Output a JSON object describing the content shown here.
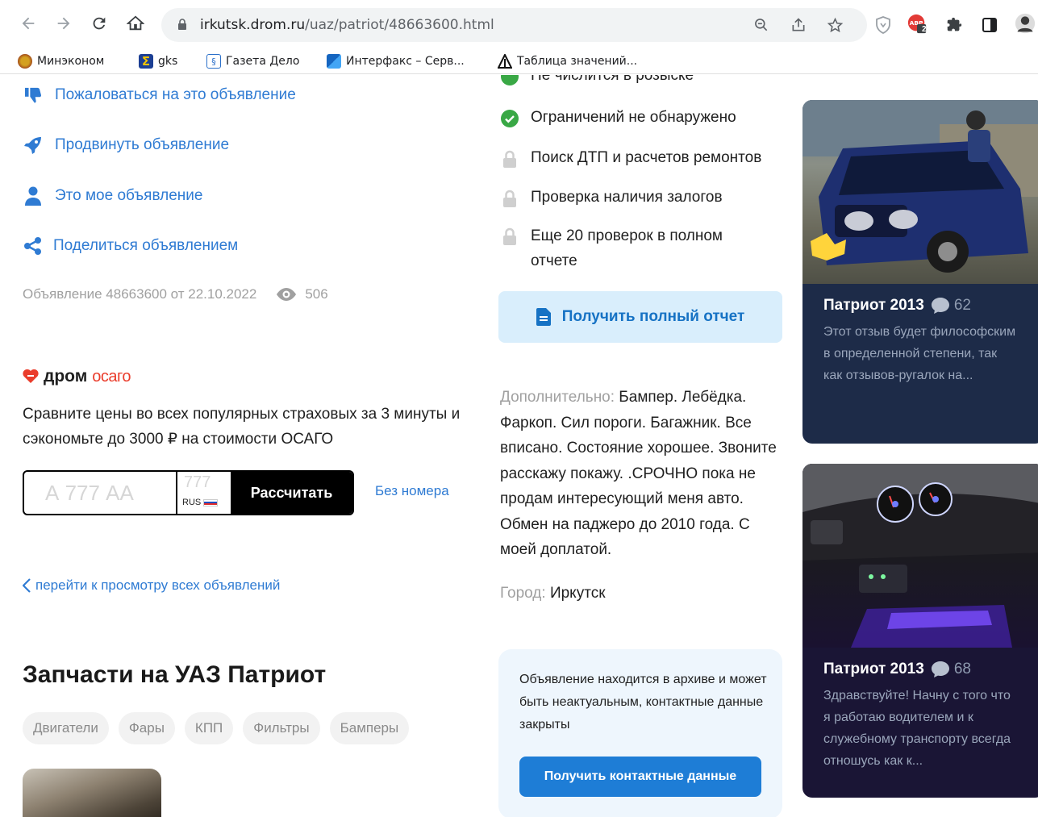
{
  "browser": {
    "url_host": "irkutsk.drom.ru",
    "url_path": "/uaz/patriot/48663600.html",
    "ext_badge": "2",
    "bookmarks": [
      {
        "label": "Минэконом"
      },
      {
        "label": "gks"
      },
      {
        "label": "Газета Дело"
      },
      {
        "label": "Интерфакс – Серв..."
      },
      {
        "label": "Таблица значений..."
      }
    ]
  },
  "actions": {
    "complain": "Пожаловаться на это объявление",
    "promote": "Продвинуть объявление",
    "mine": "Это мое объявление",
    "share": "Поделиться объявлением"
  },
  "listing_meta": {
    "text": "Объявление 48663600 от 22.10.2022",
    "views": "506"
  },
  "osago": {
    "brand": "дром",
    "product": "осаго",
    "text": "Сравните цены во всех популярных страховых за 3 минуты и сэкономьте до 3000 ₽ на стоимости ОСАГО",
    "plate_placeholder": "А 777 АА",
    "region_placeholder": "777",
    "country": "RUS",
    "calc_button": "Рассчитать",
    "no_plate_link": "Без номера"
  },
  "back_link": "перейти к просмотру всех объявлений",
  "parts": {
    "title": "Запчасти на УАЗ Патриот",
    "chips": [
      "Двигатели",
      "Фары",
      "КПП",
      "Фильтры",
      "Бамперы"
    ]
  },
  "checks": {
    "partial_top": "Не числится в розыске",
    "items": [
      {
        "label": "Ограничений не обнаружено",
        "status": "ok"
      },
      {
        "label": "Поиск ДТП и расчетов ремонтов",
        "status": "locked"
      },
      {
        "label": "Проверка наличия залогов",
        "status": "locked"
      },
      {
        "label": "Еще 20 проверок в полном отчете",
        "status": "locked"
      }
    ],
    "report_button": "Получить полный отчет"
  },
  "description": {
    "label": "Дополнительно:",
    "text": " Бампер. Лебёдка. Фаркоп. Сил пороги. Багажник. Все вписано. Состояние хорошее. Звоните расскажу покажу. .СРОЧНО пока не продам интересующий меня авто. Обмен на паджеро до 2010 года. С моей доплатой."
  },
  "city": {
    "label": "Город:",
    "value": " Иркутск"
  },
  "archive": {
    "text": "Объявление находится в архиве и может быть неактуальным, контактные данные закрыты",
    "button": "Получить контактные данные"
  },
  "reviews": [
    {
      "title": "Патриот 2013",
      "comments": "62",
      "text": "Этот отзыв будет философским в определенной степени, так как отзывов-ругалок на..."
    },
    {
      "title": "Патриот 2013",
      "comments": "68",
      "text": "Здравствуйте! Начну с того что я работаю водителем и к служебному транспорту всегда отношусь как к..."
    }
  ],
  "colors": {
    "link": "#2f7bd3",
    "osago_red": "#ea3c2b",
    "check_green": "#39a845",
    "card1_bg": "#1d2b48",
    "card2_bg": "#1a1535"
  }
}
